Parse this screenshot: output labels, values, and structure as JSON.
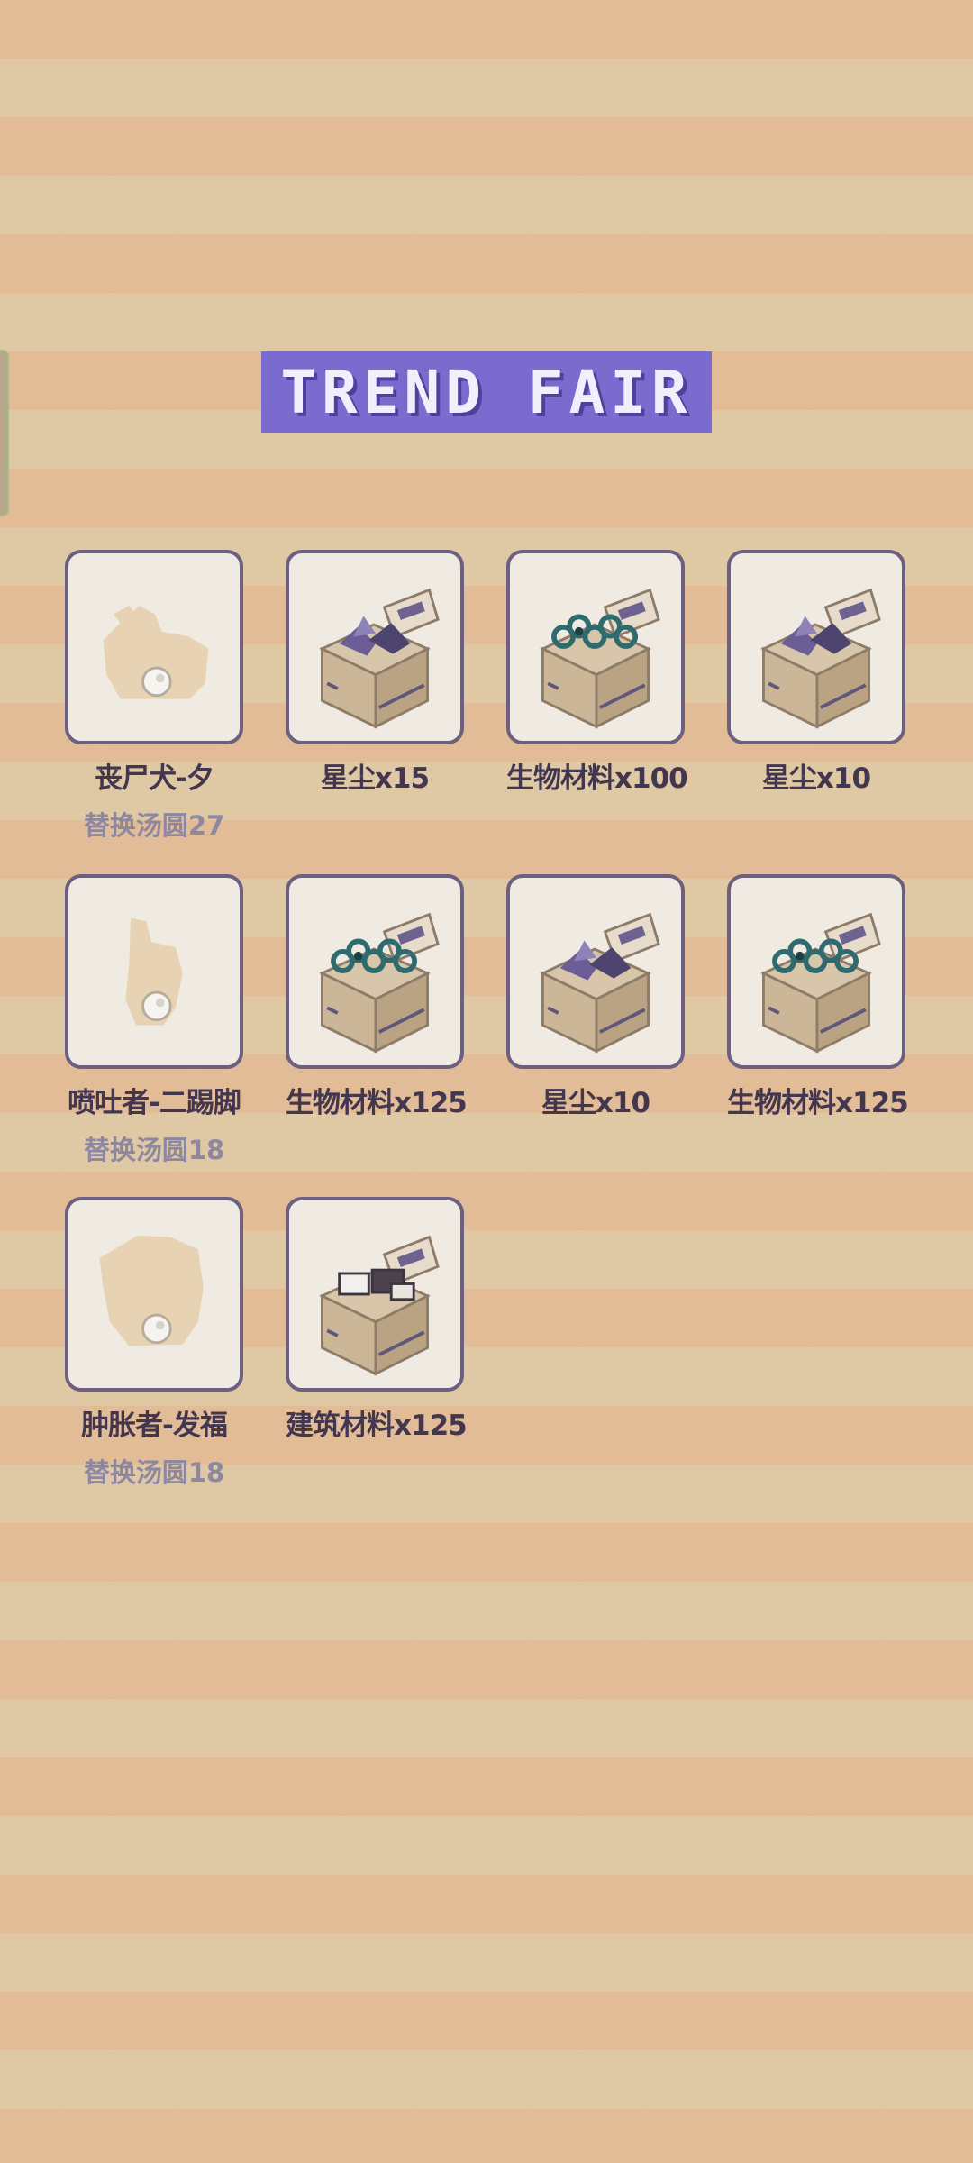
{
  "title": "TREND FAIR",
  "items": [
    {
      "label": "丧尸犬-夕",
      "sub": "替换汤圆27",
      "type": "silhouette",
      "icon": "zombie-dog-silhouette-icon"
    },
    {
      "label": "星尘x15",
      "sub": "",
      "type": "box",
      "icon": "stardust-box-icon",
      "content": "stardust"
    },
    {
      "label": "生物材料x100",
      "sub": "",
      "type": "box",
      "icon": "bio-material-box-icon",
      "content": "bio"
    },
    {
      "label": "星尘x10",
      "sub": "",
      "type": "box",
      "icon": "stardust-box-icon",
      "content": "stardust"
    },
    {
      "label": "喷吐者-二踢脚",
      "sub": "替换汤圆18",
      "type": "silhouette",
      "icon": "spitter-silhouette-icon"
    },
    {
      "label": "生物材料x125",
      "sub": "",
      "type": "box",
      "icon": "bio-material-box-icon",
      "content": "bio"
    },
    {
      "label": "星尘x10",
      "sub": "",
      "type": "box",
      "icon": "stardust-box-icon",
      "content": "stardust"
    },
    {
      "label": "生物材料x125",
      "sub": "",
      "type": "box",
      "icon": "bio-material-box-icon",
      "content": "bio"
    },
    {
      "label": "肿胀者-发福",
      "sub": "替换汤圆18",
      "type": "silhouette",
      "icon": "bloater-silhouette-icon"
    },
    {
      "label": "建筑材料x125",
      "sub": "",
      "type": "box",
      "icon": "building-material-box-icon",
      "content": "building"
    }
  ],
  "colors": {
    "background": "#dfc8a4",
    "banner": "#7b6bcf",
    "card_border": "#6d5f80",
    "card_fill": "#efebe3",
    "label": "#43364f",
    "sub_label": "#8d88a0"
  }
}
